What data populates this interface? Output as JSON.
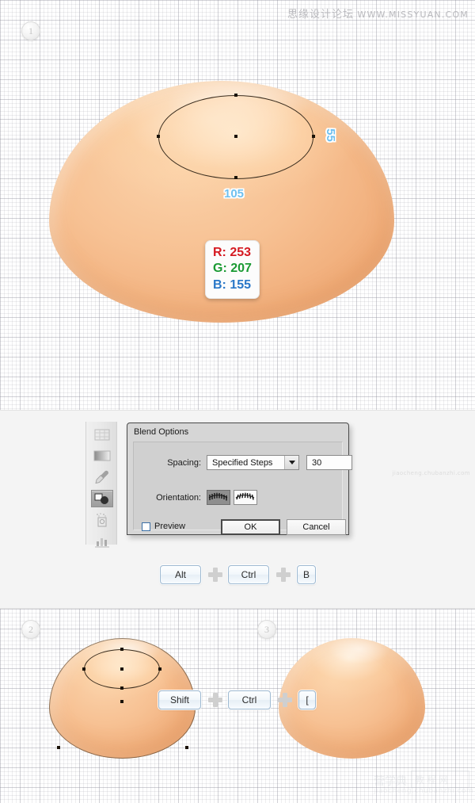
{
  "watermarks": {
    "top_cn": "思缘设计论坛",
    "top_url": "WWW.MISSYUAN.COM",
    "mid": "jiaocheng.chubanzhi.com",
    "bottom_cn": "营学典",
    "bottom_box": "教程网",
    "bottom_url": "jiaocheng.chubanzhi.com"
  },
  "steps": {
    "one": "1",
    "two": "2",
    "three": "3"
  },
  "measurements": {
    "width_label": "105",
    "height_label": "55"
  },
  "color_callout": {
    "r": "R: 253",
    "g": "G: 207",
    "b": "B: 155",
    "r_color": "#d51a22",
    "g_color": "#1a9a33",
    "b_color": "#2a78c8"
  },
  "toolbar": {
    "tools": [
      {
        "name": "mesh-tool"
      },
      {
        "name": "gradient-tool"
      },
      {
        "name": "eyedropper-tool"
      },
      {
        "name": "blend-tool",
        "active": true
      },
      {
        "name": "symbol-sprayer-tool"
      },
      {
        "name": "column-graph-tool"
      }
    ]
  },
  "dialog": {
    "title": "Blend Options",
    "spacing_label": "Spacing:",
    "spacing_value": "Specified Steps",
    "steps_value": "30",
    "orientation_label": "Orientation:",
    "preview_label": "Preview",
    "ok_label": "OK",
    "cancel_label": "Cancel"
  },
  "shortcuts": {
    "middle": [
      {
        "key": "Alt"
      },
      {
        "key": "Ctrl"
      },
      {
        "key": "B"
      }
    ],
    "bottom": [
      {
        "key": "Shift"
      },
      {
        "key": "Ctrl"
      },
      {
        "key": "["
      }
    ]
  }
}
